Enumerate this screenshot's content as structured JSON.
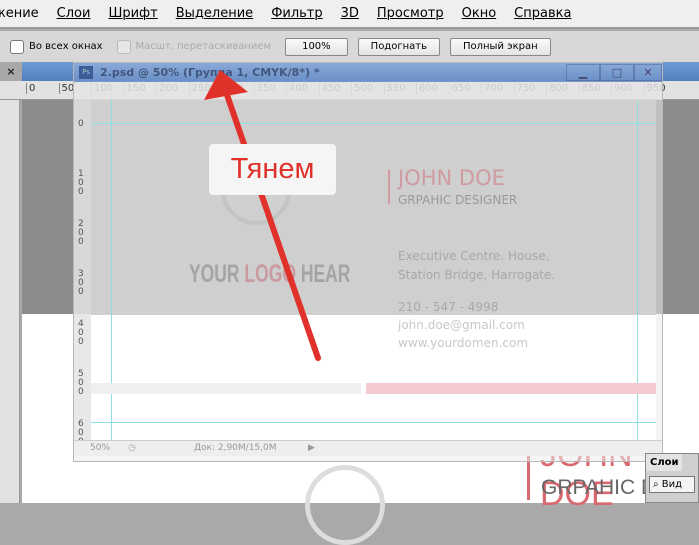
{
  "menu": [
    "жение",
    "Слои",
    "Шрифт",
    "Выделение",
    "Фильтр",
    "3D",
    "Просмотр",
    "Окно",
    "Справка"
  ],
  "options": {
    "all_windows": "Во всех окнах",
    "scrubby_zoom": "Масшт. перетаскиванием",
    "btn_100": "100%",
    "btn_fit": "Подогнать",
    "btn_full": "Полный экран"
  },
  "window": {
    "title": "2.psd @ 50% (Группа 1, CMYK/8*) *",
    "zoom": "50%",
    "doc_size": "Док: 2,90M/15,0M"
  },
  "ruler": [
    "0",
    "50",
    "100",
    "150",
    "200",
    "250",
    "300",
    "350",
    "400",
    "450",
    "500",
    "550",
    "600",
    "650",
    "700",
    "750",
    "800",
    "850",
    "900",
    "950"
  ],
  "vruler": [
    "0",
    "100",
    "200",
    "300",
    "400",
    "500",
    "600"
  ],
  "card": {
    "name": "JOHN DOE",
    "title": "GRPAHIC DESIGNER",
    "address1": "Executive Centre. House,",
    "address2": "Station Bridge, Harrogate.",
    "phone": "210 - 547 - 4998",
    "email": "john.doe@gmail.com",
    "web": "www.yourdomen.com",
    "logo1": "YOUR ",
    "logo2": "LOGO",
    "logo3": " HEAR"
  },
  "bg_card": {
    "name": "JOHN DOE",
    "title": "GRPAHIC DE"
  },
  "annotation": "Тянем",
  "layers": {
    "tab": "Слои",
    "search": "Вид"
  },
  "colors": {
    "accent": "#e0312b",
    "brand": "#d9686f"
  }
}
